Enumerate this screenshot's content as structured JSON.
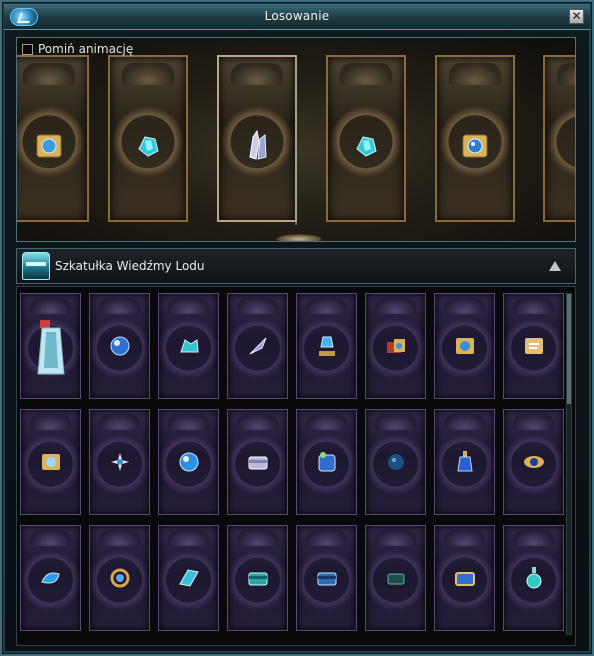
{
  "window": {
    "title": "Losowanie"
  },
  "skip_animation": {
    "label": "Pomiń animację",
    "checked": false
  },
  "reel": {
    "cards": [
      {
        "icon": "scroll-icon"
      },
      {
        "icon": "blue-crystal-icon"
      },
      {
        "icon": "white-crystal-icon"
      },
      {
        "icon": "blue-crystal-icon"
      },
      {
        "icon": "scroll-orb-icon"
      },
      {
        "icon": "empty"
      }
    ]
  },
  "box": {
    "title": "Szkatułka Wiedźmy Lodu",
    "icon": "ice-chest-icon"
  },
  "items": [
    {
      "icon": "ice-robe-icon"
    },
    {
      "icon": "blue-orb-icon"
    },
    {
      "icon": "crystal-cluster-icon"
    },
    {
      "icon": "feather-shard-icon"
    },
    {
      "icon": "blue-potion-stand-icon"
    },
    {
      "icon": "gift-bundle-icon"
    },
    {
      "icon": "scroll-icon"
    },
    {
      "icon": "scroll-white-icon"
    },
    {
      "icon": "scroll-gold-icon"
    },
    {
      "icon": "ice-sparkle-icon"
    },
    {
      "icon": "blue-orb-icon"
    },
    {
      "icon": "silver-chest-icon"
    },
    {
      "icon": "potion-bag-icon"
    },
    {
      "icon": "dark-blue-orb-icon"
    },
    {
      "icon": "blue-potion-icon"
    },
    {
      "icon": "eye-amulet-icon"
    },
    {
      "icon": "blue-shell-icon"
    },
    {
      "icon": "gold-ring-icon"
    },
    {
      "icon": "ice-bracer-icon"
    },
    {
      "icon": "teal-chest-icon"
    },
    {
      "icon": "blue-chest-icon"
    },
    {
      "icon": "dark-chest-icon"
    },
    {
      "icon": "gold-chest-icon"
    },
    {
      "icon": "teal-potion-icon"
    }
  ],
  "colors": {
    "accent": "#3f6f7c",
    "card_border_gold": "#8a6a38",
    "card_purple": "#33294a"
  }
}
